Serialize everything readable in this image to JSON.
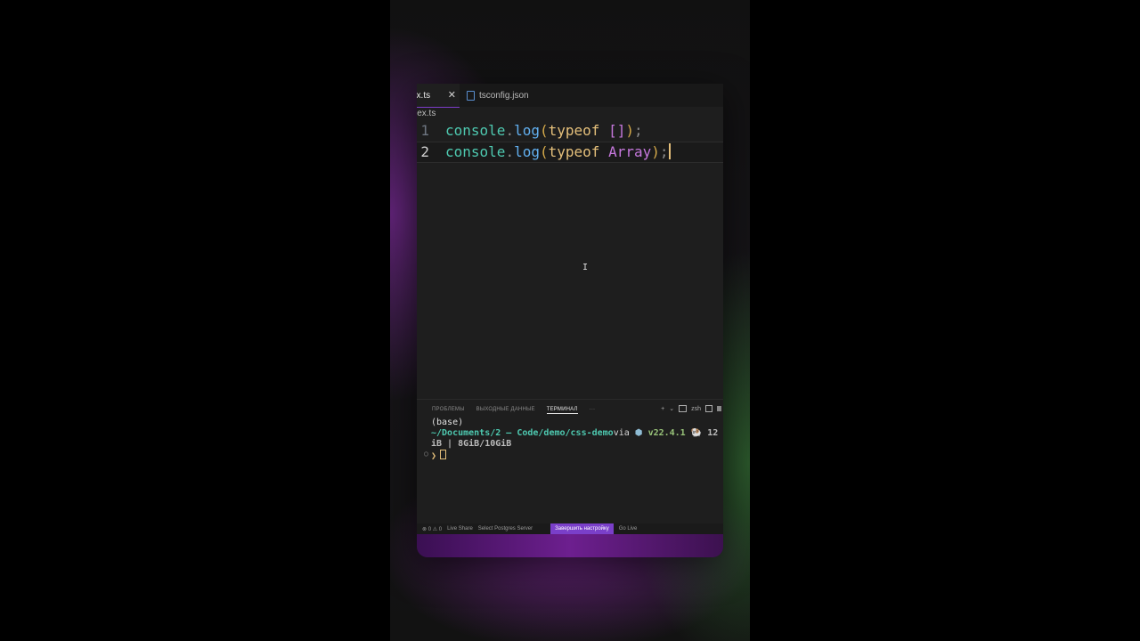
{
  "tabs": [
    {
      "label": "ex.ts",
      "active": true,
      "close_glyph": "✕"
    },
    {
      "label": "tsconfig.json",
      "active": false
    }
  ],
  "breadcrumb": "lex.ts",
  "editor": {
    "lines": [
      {
        "number": "1",
        "tokens": [
          "console",
          ".",
          "log",
          "(",
          "typeof",
          " ",
          "[]",
          ")",
          ";"
        ]
      },
      {
        "number": "2",
        "tokens": [
          "console",
          ".",
          "log",
          "(",
          "typeof",
          " ",
          "Array",
          ")",
          ";"
        ]
      }
    ]
  },
  "panel": {
    "tabs": [
      "ПРОБЛЕМЫ",
      "ВЫХОДНЫЕ ДАННЫЕ",
      "ТЕРМИНАЛ"
    ],
    "more": "···",
    "tools": {
      "add": "+",
      "chevron": "⌄",
      "shell": "zsh"
    },
    "terminal": {
      "line1": "(base)",
      "path": "~/Documents/2 – Code/demo/css-demo",
      "via": "via",
      "node_icon": "⬢",
      "node_version": "v22.4.1",
      "mem_icon": "🐏",
      "mem_tail": "12",
      "line3": "iB | 8GiB/10GiB",
      "prompt": "❯",
      "marker": "○"
    }
  },
  "statusbar": {
    "problems": "⊗ 0 ⚠ 0",
    "live_share": "Live Share",
    "postgres": "Select Postgres Server",
    "setup": "Завершить настройку",
    "go_live": "Go Live"
  },
  "colors": {
    "accent": "#7a3fc9",
    "keyword": "#e5c07b",
    "object": "#4ec9b0",
    "function": "#61afef",
    "array": "#c678dd"
  }
}
